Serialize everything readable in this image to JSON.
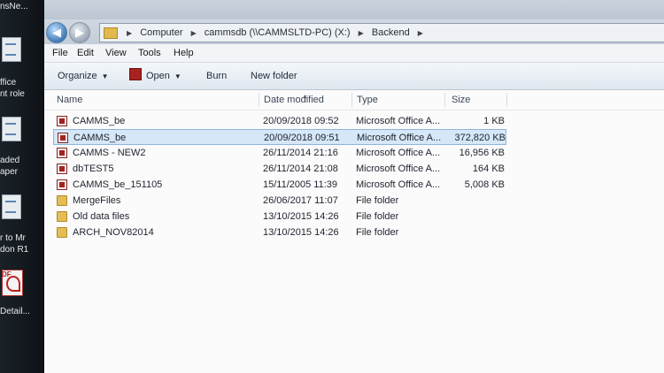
{
  "desktop": {
    "items": [
      {
        "label_top": "nsNe...",
        "label_bottom": ""
      },
      {
        "label_top": "ffice",
        "label_bottom": "nt role"
      },
      {
        "label_top": "aded",
        "label_bottom": "aper"
      },
      {
        "label_top": "r to Mr",
        "label_bottom": "don R1"
      },
      {
        "label_top": "DF",
        "label_bottom": "Detail..."
      }
    ]
  },
  "address": {
    "crumbs": [
      "Computer",
      "cammsdb (\\\\CAMMSLTD-PC) (X:)",
      "Backend"
    ]
  },
  "menu": [
    "File",
    "Edit",
    "View",
    "Tools",
    "Help"
  ],
  "toolbar": {
    "organize": "Organize",
    "open": "Open",
    "burn": "Burn",
    "new_folder": "New folder"
  },
  "columns": {
    "name": "Name",
    "date": "Date modified",
    "type": "Type",
    "size": "Size"
  },
  "files": [
    {
      "name": "CAMMS_be",
      "date": "20/09/2018 09:52",
      "type": "Microsoft Office A...",
      "size": "1 KB",
      "icon": "access-file-icon"
    },
    {
      "name": "CAMMS_be",
      "date": "20/09/2018 09:51",
      "type": "Microsoft Office A...",
      "size": "372,820 KB",
      "icon": "access-file-icon",
      "selected": true
    },
    {
      "name": "CAMMS - NEW2",
      "date": "26/11/2014 21:16",
      "type": "Microsoft Office A...",
      "size": "16,956 KB",
      "icon": "access-file-icon"
    },
    {
      "name": "dbTEST5",
      "date": "26/11/2014 21:08",
      "type": "Microsoft Office A...",
      "size": "164 KB",
      "icon": "access-file-icon"
    },
    {
      "name": "CAMMS_be_151105",
      "date": "15/11/2005 11:39",
      "type": "Microsoft Office A...",
      "size": "5,008 KB",
      "icon": "access-file-icon"
    },
    {
      "name": "MergeFiles",
      "date": "26/06/2017 11:07",
      "type": "File folder",
      "size": "",
      "icon": "folder-icon"
    },
    {
      "name": "Old data files",
      "date": "13/10/2015 14:26",
      "type": "File folder",
      "size": "",
      "icon": "folder-icon"
    },
    {
      "name": "ARCH_NOV82014",
      "date": "13/10/2015 14:26",
      "type": "File folder",
      "size": "",
      "icon": "folder-icon"
    }
  ]
}
